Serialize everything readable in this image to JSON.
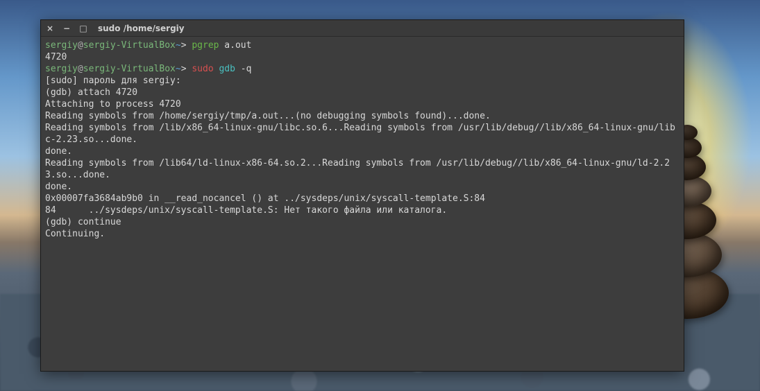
{
  "window": {
    "title": "sudo  /home/sergiy",
    "close_label": "×",
    "minimize_label": "−",
    "maximize_label": "□"
  },
  "prompt": {
    "user": "sergiy",
    "at": "@",
    "host": "sergiy-VirtualBox",
    "tilde": "~",
    "arrow": ">"
  },
  "line1": {
    "cmd": "pgrep",
    "arg": " a.out"
  },
  "line2": {
    "output": "4720"
  },
  "line3": {
    "cmd1": "sudo",
    "cmd2": " gdb",
    "arg": " -q"
  },
  "line4": "[sudo] пароль для sergiy: ",
  "line5": "(gdb) attach 4720",
  "line6": "Attaching to process 4720",
  "line7": "Reading symbols from /home/sergiy/tmp/a.out...(no debugging symbols found)...done.",
  "line8": "Reading symbols from /lib/x86_64-linux-gnu/libc.so.6...Reading symbols from /usr/lib/debug//lib/x86_64-linux-gnu/libc-2.23.so...done.",
  "line9": "done.",
  "line10": "Reading symbols from /lib64/ld-linux-x86-64.so.2...Reading symbols from /usr/lib/debug//lib/x86_64-linux-gnu/ld-2.23.so...done.",
  "line11": "done.",
  "line12": "0x00007fa3684ab9b0 in __read_nocancel () at ../sysdeps/unix/syscall-template.S:84",
  "line13": "84      ../sysdeps/unix/syscall-template.S: Нет такого файла или каталога.",
  "line14": "(gdb) continue",
  "line15": "Continuing."
}
